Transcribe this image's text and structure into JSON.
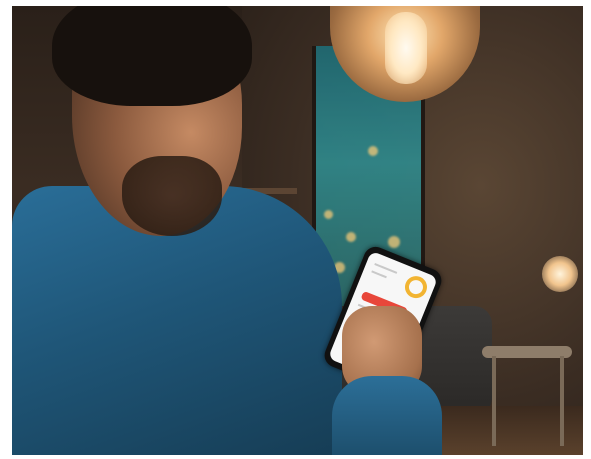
{
  "scene": {
    "subject": "man-holding-smartphone",
    "accent_colors": {
      "screen_bar": "#e8473a",
      "screen_ring": "#f2b432",
      "window_teal": "#2f8b8e",
      "shirt_blue": "#1f5678"
    }
  },
  "phone_app": {
    "bars": [
      {
        "fill": 0.85
      },
      {
        "fill": 0.7
      }
    ],
    "ring_level": 0.75
  }
}
